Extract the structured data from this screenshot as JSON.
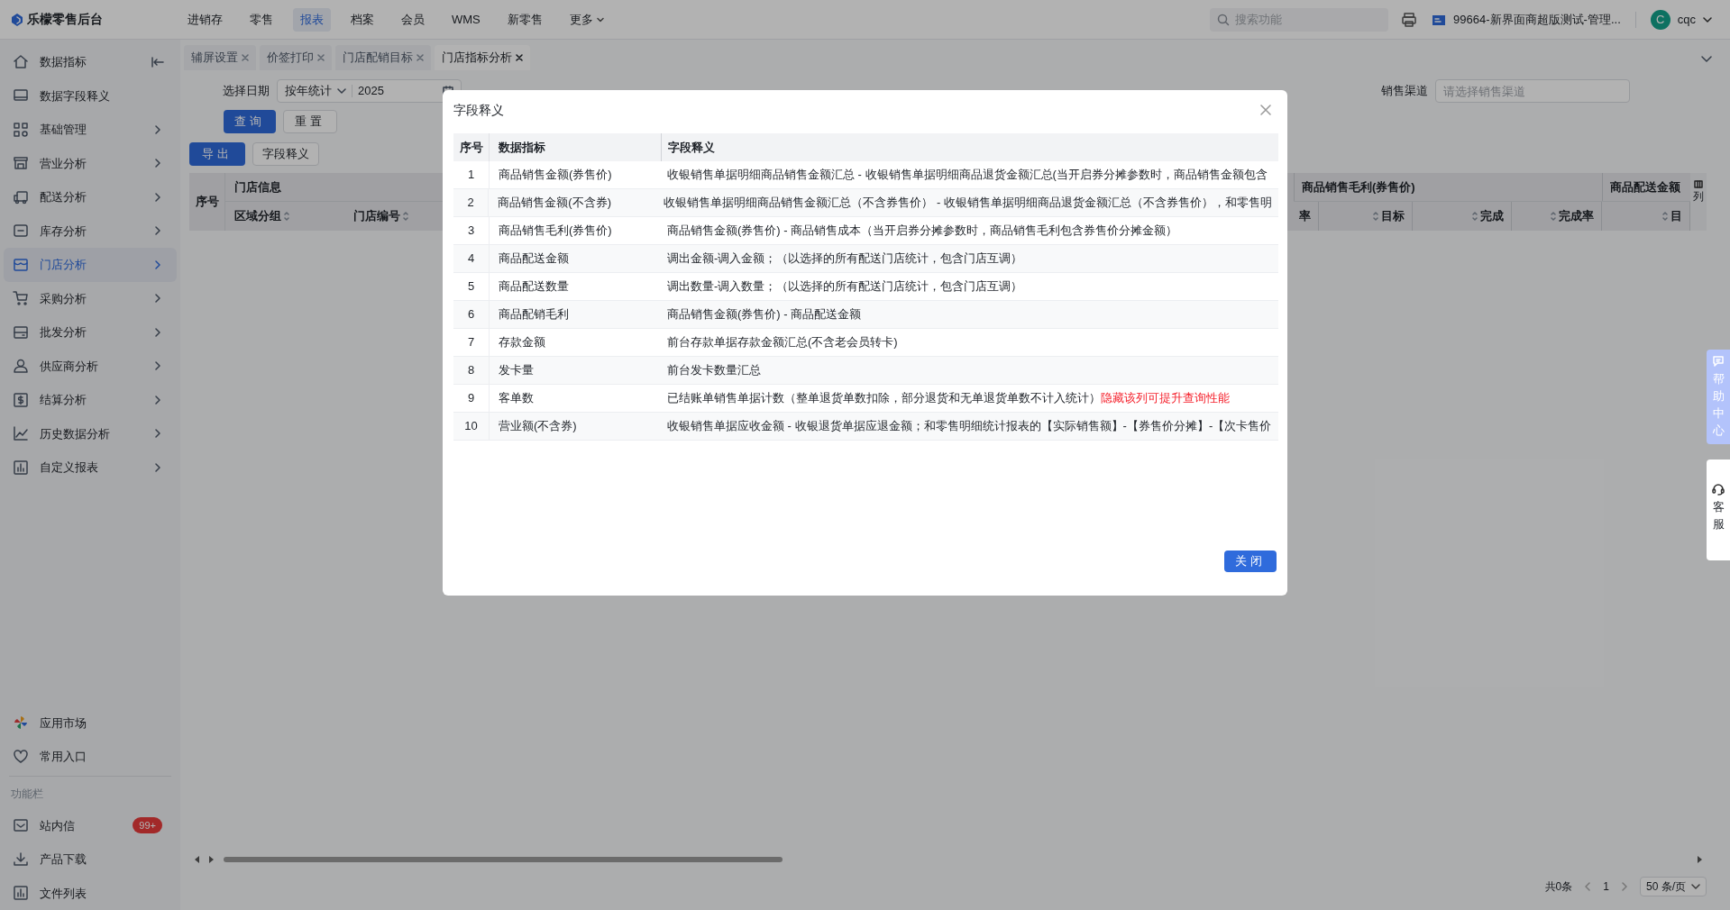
{
  "app": {
    "logo": "乐檬零售后台",
    "nav": [
      {
        "label": "进销存",
        "selected": false
      },
      {
        "label": "零售",
        "selected": false
      },
      {
        "label": "报表",
        "selected": true
      },
      {
        "label": "档案",
        "selected": false
      },
      {
        "label": "会员",
        "selected": false
      },
      {
        "label": "WMS",
        "selected": false
      },
      {
        "label": "新零售",
        "selected": false
      }
    ],
    "more": "更多",
    "search": {
      "placeholder": "搜索功能"
    },
    "store": "99664-新界面商超版测试-管理...",
    "user": {
      "initial": "C",
      "name": "cqc"
    }
  },
  "sidebar": {
    "items": [
      {
        "label": "数据指标",
        "selected": false,
        "expandable": false
      },
      {
        "label": "数据字段释义",
        "selected": false,
        "expandable": false
      },
      {
        "label": "基础管理",
        "selected": false,
        "expandable": true
      },
      {
        "label": "营业分析",
        "selected": false,
        "expandable": true
      },
      {
        "label": "配送分析",
        "selected": false,
        "expandable": true
      },
      {
        "label": "库存分析",
        "selected": false,
        "expandable": true
      },
      {
        "label": "门店分析",
        "selected": true,
        "expandable": true
      },
      {
        "label": "采购分析",
        "selected": false,
        "expandable": true
      },
      {
        "label": "批发分析",
        "selected": false,
        "expandable": true
      },
      {
        "label": "供应商分析",
        "selected": false,
        "expandable": true
      },
      {
        "label": "结算分析",
        "selected": false,
        "expandable": true
      },
      {
        "label": "历史数据分析",
        "selected": false,
        "expandable": true
      },
      {
        "label": "自定义报表",
        "selected": false,
        "expandable": true
      }
    ],
    "shortcuts": [
      "应用市场",
      "常用入口"
    ],
    "section": "功能栏",
    "tools": [
      {
        "label": "站内信",
        "badge": "99+"
      },
      {
        "label": "产品下载"
      },
      {
        "label": "文件列表"
      }
    ]
  },
  "tabs": [
    {
      "label": "辅屏设置",
      "selected": false
    },
    {
      "label": "价签打印",
      "selected": false
    },
    {
      "label": "门店配销目标",
      "selected": false
    },
    {
      "label": "门店指标分析",
      "selected": true
    }
  ],
  "filters": {
    "date_label": "选择日期",
    "mode": "按年统计",
    "year": "2025",
    "channel_label": "销售渠道",
    "channel_placeholder": "请选择销售渠道",
    "query_button": "查询",
    "reset_button": "重置"
  },
  "toolbar": {
    "export_button": "导出",
    "fields_button": "字段释义"
  },
  "table": {
    "row_number": "序号",
    "left_group": "门店信息",
    "left_columns": [
      "区域分组",
      "门店编号"
    ],
    "right_groups": [
      "商品销售毛利(券售价)",
      "商品配送金额"
    ],
    "right_columns": [
      "率",
      "目标",
      "完成",
      "完成率",
      "目"
    ],
    "column_settings": "列"
  },
  "pagination": {
    "total": "共0条",
    "page": "1",
    "page_size": "50 条/页"
  },
  "floats": {
    "help": "帮助中心",
    "service": "客服"
  },
  "modal": {
    "title": "字段释义",
    "columns": [
      "序号",
      "数据指标",
      "字段释义"
    ],
    "rows": [
      {
        "no": "1",
        "metric": "商品销售金额(券售价)",
        "definition": "收银销售单据明细商品销售金额汇总 - 收银销售单据明细商品退货金额汇总(当开启券分摊参数时，商品销售金额包含"
      },
      {
        "no": "2",
        "metric": "商品销售金额(不含券)",
        "definition": "收银销售单据明细商品销售金额汇总（不含券售价） - 收银销售单据明细商品退货金额汇总（不含券售价），和零售明"
      },
      {
        "no": "3",
        "metric": "商品销售毛利(券售价)",
        "definition": "商品销售金额(券售价) - 商品销售成本（当开启券分摊参数时，商品销售毛利包含券售价分摊金额）"
      },
      {
        "no": "4",
        "metric": "商品配送金额",
        "definition": "调出金额-调入金额；（以选择的所有配送门店统计，包含门店互调）"
      },
      {
        "no": "5",
        "metric": "商品配送数量",
        "definition": "调出数量-调入数量；（以选择的所有配送门店统计，包含门店互调）"
      },
      {
        "no": "6",
        "metric": "商品配销毛利",
        "definition": "商品销售金额(券售价) - 商品配送金额"
      },
      {
        "no": "7",
        "metric": "存款金额",
        "definition": "前台存款单据存款金额汇总(不含老会员转卡)"
      },
      {
        "no": "8",
        "metric": "发卡量",
        "definition": "前台发卡数量汇总"
      },
      {
        "no": "9",
        "metric": "客单数",
        "definition": "已结账单销售单据计数（整单退货单数扣除，部分退货和无单退货单数不计入统计）",
        "note": "隐藏该列可提升查询性能"
      },
      {
        "no": "10",
        "metric": "营业额(不含券)",
        "definition": "收银销售单据应收金额 - 收银退货单据应退金额；和零售明细统计报表的【实际销售额】-【券售价分摊】-【次卡售价"
      }
    ],
    "close_button": "关闭"
  }
}
